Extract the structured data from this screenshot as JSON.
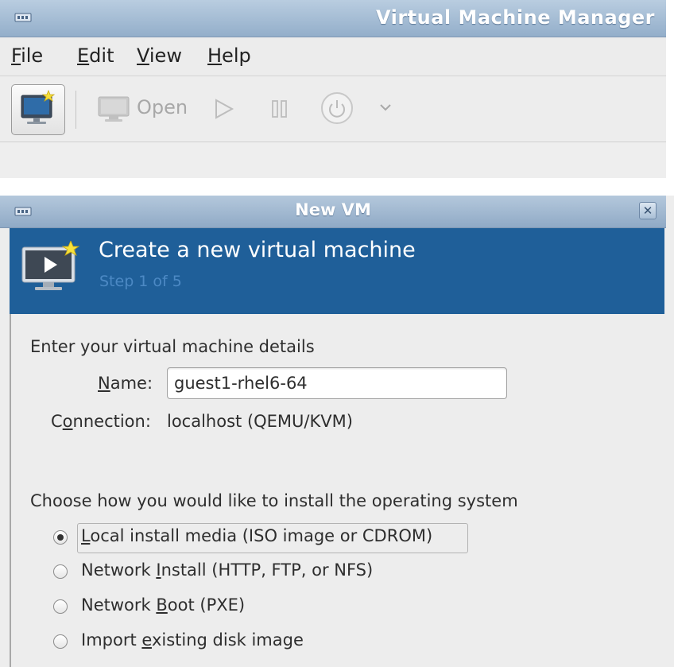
{
  "main_window": {
    "title": "Virtual Machine Manager",
    "menu": [
      {
        "pre": "",
        "key": "F",
        "post": "ile"
      },
      {
        "pre": "",
        "key": "E",
        "post": "dit"
      },
      {
        "pre": "",
        "key": "V",
        "post": "iew"
      },
      {
        "pre": "",
        "key": "H",
        "post": "elp"
      }
    ],
    "toolbar": {
      "open_label": "Open"
    }
  },
  "dialog": {
    "title": "New VM",
    "close_icon": "✕",
    "header": {
      "title": "Create a new virtual machine",
      "step": "Step 1 of 5"
    },
    "details_heading": "Enter your virtual machine details",
    "name_label": {
      "pre": "",
      "key": "N",
      "post": "ame:"
    },
    "name_value": "guest1-rhel6-64",
    "connection_label": {
      "pre": "C",
      "key": "o",
      "post": "nnection:"
    },
    "connection_value": "localhost (QEMU/KVM)",
    "install_heading": "Choose how you would like to install the operating system",
    "install_options": [
      {
        "pre": "",
        "key": "L",
        "post": "ocal install media (ISO image or CDROM)",
        "selected": true
      },
      {
        "pre": "Network ",
        "key": "I",
        "post": "nstall (HTTP, FTP, or NFS)",
        "selected": false
      },
      {
        "pre": "Network ",
        "key": "B",
        "post": "oot (PXE)",
        "selected": false
      },
      {
        "pre": "Import ",
        "key": "e",
        "post": "xisting disk image",
        "selected": false
      }
    ]
  },
  "colors": {
    "titlebar": "#a7bfd8",
    "banner": "#1f5f99",
    "banner_step_text": "#4c89c4"
  }
}
